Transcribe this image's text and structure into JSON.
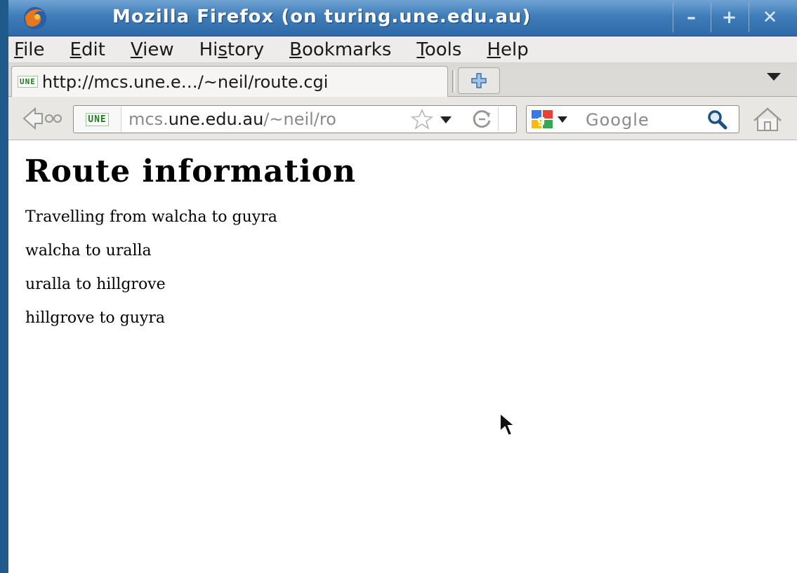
{
  "window": {
    "title": "Mozilla Firefox (on turing.une.edu.au)",
    "controls": {
      "minimize": "–",
      "maximize": "+",
      "close": "✕"
    }
  },
  "menubar": {
    "items": [
      {
        "label": "File",
        "mnemonic": "F",
        "rest": "ile"
      },
      {
        "label": "Edit",
        "mnemonic": "E",
        "rest": "dit"
      },
      {
        "label": "View",
        "mnemonic": "V",
        "rest": "iew"
      },
      {
        "label": "History",
        "pre": "Hi",
        "mnemonic": "s",
        "rest": "tory"
      },
      {
        "label": "Bookmarks",
        "mnemonic": "B",
        "rest": "ookmarks"
      },
      {
        "label": "Tools",
        "mnemonic": "T",
        "rest": "ools"
      },
      {
        "label": "Help",
        "mnemonic": "H",
        "rest": "elp"
      }
    ]
  },
  "tabs": {
    "active": {
      "favicon": "UNE",
      "title": "http://mcs.une.e…/~neil/route.cgi"
    },
    "new_tab_icon": "plus-icon",
    "list_icon": "chevron-down-icon"
  },
  "navbar": {
    "identity_badge": "UNE",
    "url_prefix": "mcs.",
    "url_host": "une.edu.au",
    "url_path": "/~neil/ro",
    "search_placeholder": "Google"
  },
  "page": {
    "heading": "Route information",
    "lines": [
      "Travelling from walcha to guyra",
      "walcha to uralla",
      "uralla to hillgrove",
      "hillgrove to guyra"
    ]
  },
  "colors": {
    "titlebar": "#3f7cb8",
    "window_border": "#1f5a8a",
    "une_green": "#1c7a1c"
  }
}
